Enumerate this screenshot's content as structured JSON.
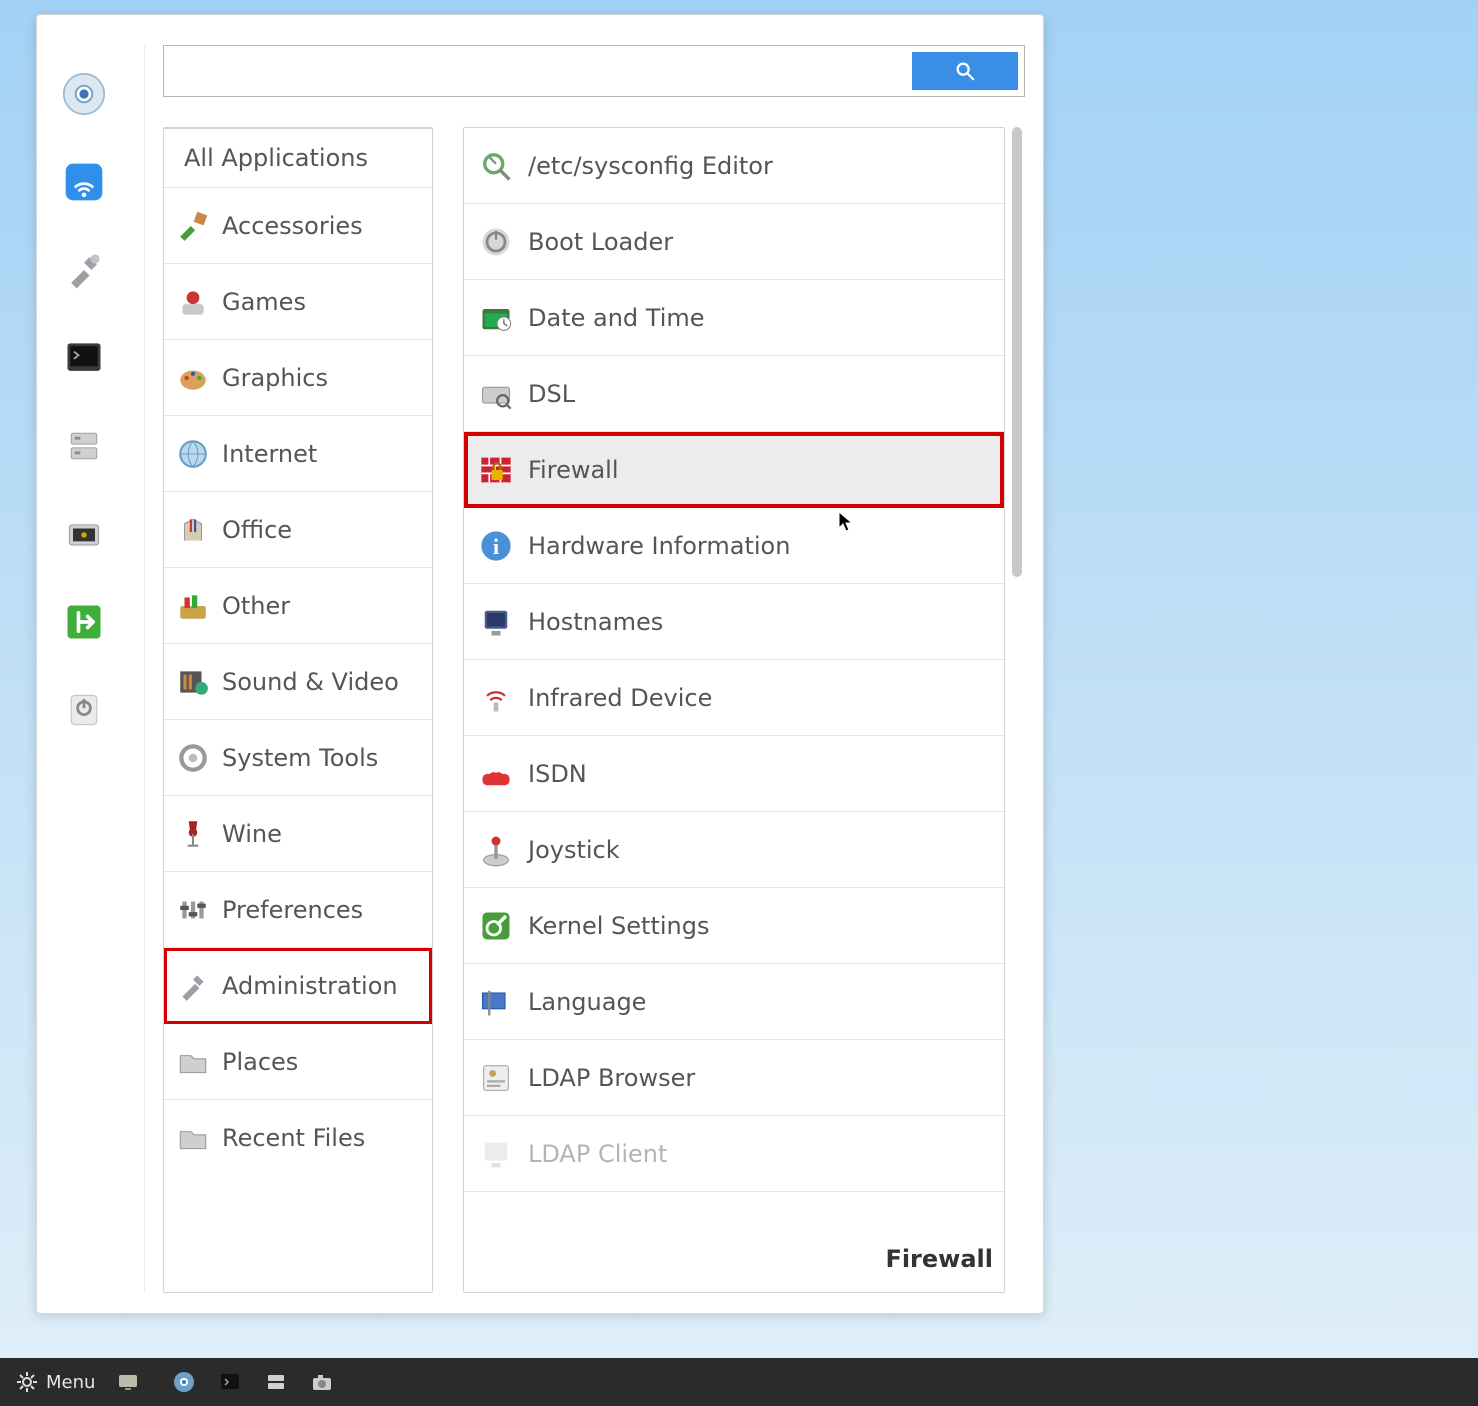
{
  "search": {
    "value": ""
  },
  "favorites": [
    {
      "icon": "chromium-icon"
    },
    {
      "icon": "wifi-icon"
    },
    {
      "icon": "tools-icon"
    },
    {
      "icon": "terminal-icon"
    },
    {
      "icon": "file-manager-icon"
    },
    {
      "icon": "keyring-icon"
    },
    {
      "icon": "logout-icon"
    },
    {
      "icon": "shutdown-icon"
    }
  ],
  "categories": [
    {
      "label": "All Applications",
      "icon": null
    },
    {
      "label": "Accessories",
      "icon": "accessories-icon"
    },
    {
      "label": "Games",
      "icon": "games-icon"
    },
    {
      "label": "Graphics",
      "icon": "graphics-icon"
    },
    {
      "label": "Internet",
      "icon": "internet-icon"
    },
    {
      "label": "Office",
      "icon": "office-icon"
    },
    {
      "label": "Other",
      "icon": "other-icon"
    },
    {
      "label": "Sound & Video",
      "icon": "multimedia-icon"
    },
    {
      "label": "System Tools",
      "icon": "system-tools-icon"
    },
    {
      "label": "Wine",
      "icon": "wine-icon"
    },
    {
      "label": "Preferences",
      "icon": "preferences-icon"
    },
    {
      "label": "Administration",
      "icon": "administration-icon",
      "highlight": true
    },
    {
      "label": "Places",
      "icon": "folder-icon"
    },
    {
      "label": "Recent Files",
      "icon": "folder-icon"
    }
  ],
  "apps": [
    {
      "label": "/etc/sysconfig Editor",
      "icon": "sysconfig-icon"
    },
    {
      "label": "Boot Loader",
      "icon": "power-icon"
    },
    {
      "label": "Date and Time",
      "icon": "datetime-icon"
    },
    {
      "label": "DSL",
      "icon": "dsl-icon"
    },
    {
      "label": "Firewall",
      "icon": "firewall-icon",
      "highlight": true
    },
    {
      "label": "Hardware Information",
      "icon": "info-icon"
    },
    {
      "label": "Hostnames",
      "icon": "hostnames-icon"
    },
    {
      "label": "Infrared Device",
      "icon": "infrared-icon"
    },
    {
      "label": "ISDN",
      "icon": "isdn-icon"
    },
    {
      "label": "Joystick",
      "icon": "joystick-icon"
    },
    {
      "label": "Kernel Settings",
      "icon": "kernel-icon"
    },
    {
      "label": "Language",
      "icon": "language-icon"
    },
    {
      "label": "LDAP Browser",
      "icon": "ldap-browser-icon"
    },
    {
      "label": "LDAP Client",
      "icon": "ldap-client-icon",
      "faded": true
    }
  ],
  "tooltip": "Firewall",
  "taskbar": {
    "menu_label": "Menu"
  },
  "colors": {
    "highlight_red": "#d40000",
    "search_blue": "#3b8ee6"
  }
}
